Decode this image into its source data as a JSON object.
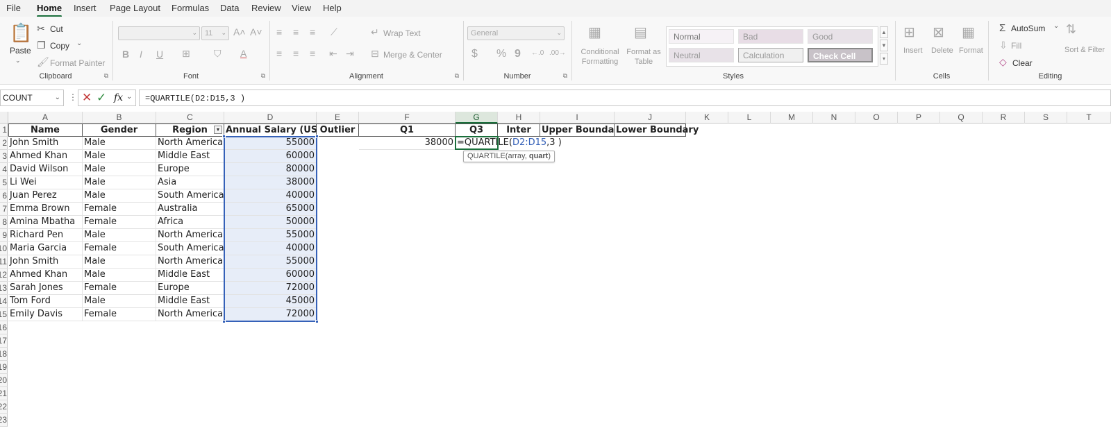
{
  "menu": [
    "File",
    "Home",
    "Insert",
    "Page Layout",
    "Formulas",
    "Data",
    "Review",
    "View",
    "Help"
  ],
  "active_menu": "Home",
  "ribbon": {
    "clipboard": {
      "label": "Clipboard",
      "paste": "Paste",
      "cut": "Cut",
      "copy": "Copy",
      "format_painter": "Format Painter"
    },
    "font": {
      "label": "Font",
      "size": "11",
      "bold": "B",
      "italic": "I",
      "underline": "U"
    },
    "alignment": {
      "label": "Alignment",
      "wrap_text": "Wrap Text",
      "merge_center": "Merge & Center"
    },
    "number": {
      "label": "Number",
      "format": "General",
      "currency": "$",
      "percent": "%",
      "comma": "9"
    },
    "styles": {
      "label": "Styles",
      "conditional_formatting": "Conditional Formatting",
      "format_as_table": "Format as Table",
      "cells": [
        "Normal",
        "Bad",
        "Good",
        "Neutral",
        "Calculation",
        "Check Cell"
      ]
    },
    "cells": {
      "label": "Cells",
      "insert": "Insert",
      "delete": "Delete",
      "format": "Format"
    },
    "editing": {
      "label": "Editing",
      "autosum": "AutoSum",
      "fill": "Fill",
      "clear": "Clear",
      "sort_filter": "Sort & Filter"
    }
  },
  "formula_bar": {
    "name_box": "COUNT",
    "fx": "fx",
    "formula": "=QUARTILE(D2:D15,3 )"
  },
  "columns": [
    "A",
    "B",
    "C",
    "D",
    "E",
    "F",
    "G",
    "H",
    "I",
    "J",
    "K",
    "L",
    "M",
    "N",
    "O",
    "P",
    "Q",
    "R",
    "S",
    "T"
  ],
  "row_numbers": [
    "1",
    "2",
    "3",
    "4",
    "5",
    "6",
    "7",
    "8",
    "9",
    "10",
    "11",
    "12",
    "13",
    "14",
    "15",
    "16",
    "17",
    "18",
    "19",
    "20",
    "21",
    "22",
    "23"
  ],
  "headers": [
    "Name",
    "Gender",
    "Region",
    "Annual Salary (USD)",
    "Outlier",
    "Q1",
    "Q3",
    "Inter",
    "Upper  Boundary",
    "Lower Boundary"
  ],
  "rows": [
    [
      "John Smith",
      "Male",
      "North America",
      "55000"
    ],
    [
      "Ahmed Khan",
      "Male",
      "Middle East",
      "60000"
    ],
    [
      "David Wilson",
      "Male",
      "Europe",
      "80000"
    ],
    [
      "Li Wei",
      "Male",
      "Asia",
      "38000"
    ],
    [
      "Juan Perez",
      "Male",
      "South America",
      "40000"
    ],
    [
      "Emma Brown",
      "Female",
      "Australia",
      "65000"
    ],
    [
      "Amina Mbatha",
      "Female",
      "Africa",
      "50000"
    ],
    [
      "Richard Pen",
      "Male",
      "North America",
      "55000"
    ],
    [
      "Maria Garcia",
      "Female",
      "South America",
      "40000"
    ],
    [
      "John Smith",
      "Male",
      "North America",
      "55000"
    ],
    [
      "Ahmed Khan",
      "Male",
      "Middle East",
      "60000"
    ],
    [
      "Sarah Jones",
      "Female",
      "Europe",
      "72000"
    ],
    [
      "Tom Ford",
      "Male",
      "Middle East",
      "45000"
    ],
    [
      "Emily Davis",
      "Female",
      "North America",
      "72000"
    ]
  ],
  "q1_value": "38000",
  "active_cell": {
    "column": "G",
    "row": "2",
    "prefix": "=QUARTILE(",
    "range": "D2:D15",
    "suffix": ",3 )"
  },
  "tooltip": {
    "func": "QUARTILE(array, ",
    "bold_arg": "quart",
    "end": ")"
  },
  "colors": {
    "accent": "#1a6f3b",
    "range": "#3561b8",
    "range_fill": "#e7edf8"
  }
}
